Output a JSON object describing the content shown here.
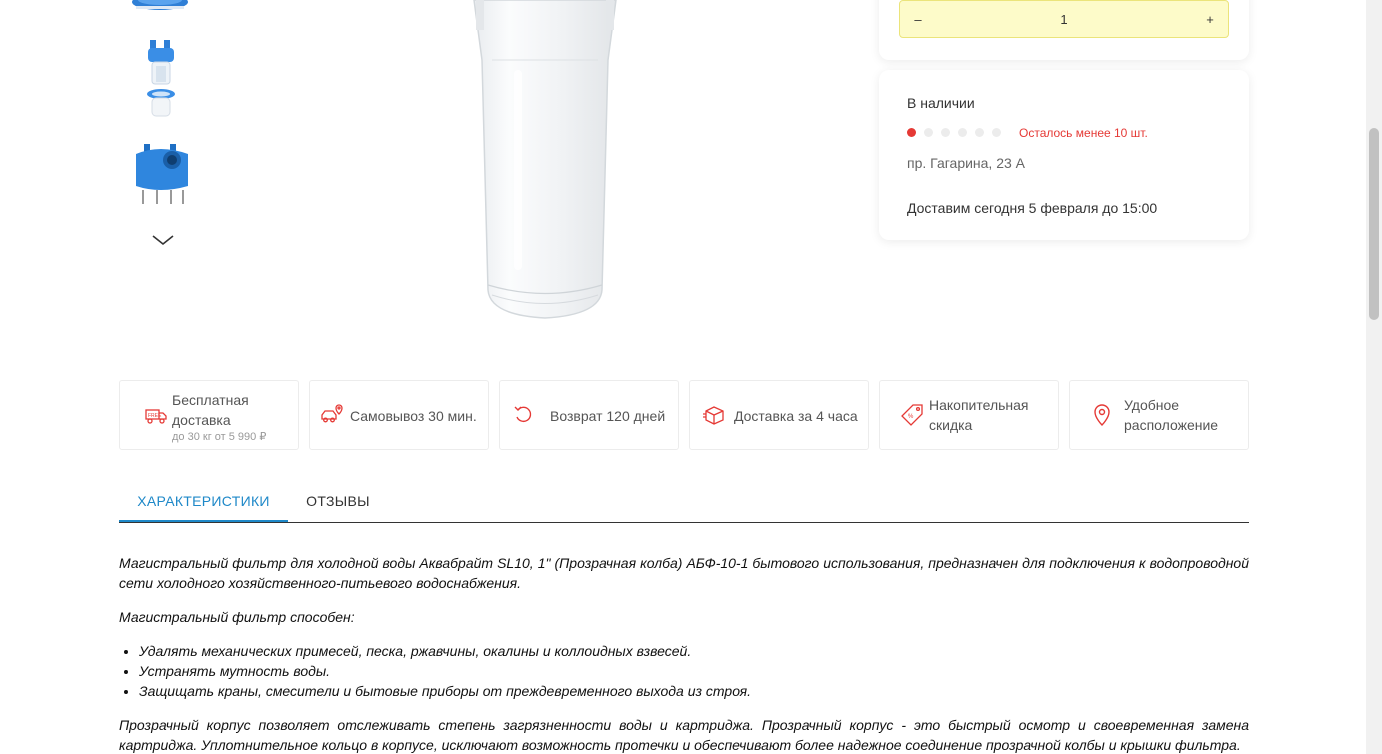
{
  "quantity": {
    "minus_label": "–",
    "value": "1",
    "plus_label": "+"
  },
  "stock": {
    "title": "В наличии",
    "level": {
      "filled": 1,
      "total": 6
    },
    "note": "Осталось менее 10 шт.",
    "address": "пр. Гагарина, 23 А",
    "delivery": "Доставим сегодня 5 февраля до 15:00"
  },
  "features": [
    {
      "icon": "delivery-truck-icon",
      "title": "Бесплатная доставка",
      "subtitle": "до 30 кг от 5 990 ₽"
    },
    {
      "icon": "pickup-car-icon",
      "title": "Самовывоз 30 мин."
    },
    {
      "icon": "return-arrow-icon",
      "title": "Возврат 120 дней"
    },
    {
      "icon": "package-box-icon",
      "title": "Доставка за 4 часа"
    },
    {
      "icon": "discount-tag-icon",
      "title": "Накопительная скидка"
    },
    {
      "icon": "location-pin-icon",
      "title": "Удобное расположение"
    }
  ],
  "tabs": [
    {
      "label": "ХАРАКТЕРИСТИКИ",
      "active": true
    },
    {
      "label": "ОТЗЫВЫ",
      "active": false
    }
  ],
  "description": {
    "p1": "Магистральный фильтр для холодной воды Аквабрайт SL10, 1\" (Прозрачная колба) АБФ-10-1 бытового использования, предназначен для подключения к водопроводной сети холодного хозяйственного-питьевого водоснабжения.",
    "p2": "Магистральный фильтр способен:",
    "list": [
      "Удалять механических примесей, песка, ржавчины, окалины и коллоидных взвесей.",
      "Устранять мутность воды.",
      "Защищать краны, смесители и бытовые приборы от преждевременного выхода из строя."
    ],
    "p3": "Прозрачный корпус позволяет отслеживать степень загрязненности воды и картриджа. Прозрачный корпус - это быстрый осмотр и своевременная замена картриджа. Уплотнительное кольцо в корпусе, исключают возможность протечки и обеспечивают более надежное соединение прозрачной колбы и крышки фильтра."
  },
  "colors": {
    "accent": "#1e88c8",
    "alert": "#e53935",
    "qty_bg": "#fdfbc9"
  }
}
